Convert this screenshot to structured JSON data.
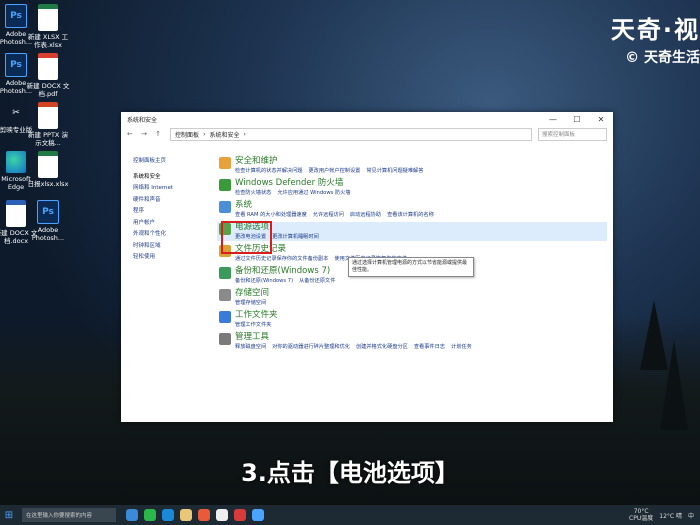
{
  "desktop": {
    "icons": [
      {
        "label": "Adobe Photosh...",
        "type": "ps",
        "glyph": "Ps"
      },
      {
        "label": "新建 XLSX 工作表.xlsx",
        "type": "xl",
        "glyph": ""
      },
      {
        "label": "Adobe Photosh...",
        "type": "ps",
        "glyph": "Ps"
      },
      {
        "label": "新建 DOCX 文档.pdf",
        "type": "pdf",
        "glyph": ""
      },
      {
        "label": "剪映专业版",
        "type": "capcut",
        "glyph": "✂"
      },
      {
        "label": "新建 PPTX 演示文稿...",
        "type": "ppt",
        "glyph": ""
      },
      {
        "label": "Microsoft Edge",
        "type": "edge",
        "glyph": ""
      },
      {
        "label": "日报xlsx.xlsx",
        "type": "xl",
        "glyph": ""
      },
      {
        "label": "新建 DOCX 文档.docx",
        "type": "doc",
        "glyph": "W"
      },
      {
        "label": "Adobe Photosh...",
        "type": "ps",
        "glyph": "Ps"
      }
    ]
  },
  "brand": {
    "line1": "天奇·视",
    "line2": "© 天奇生活"
  },
  "window": {
    "title": "系统和安全",
    "controls": {
      "minimize": "—",
      "maximize": "☐",
      "close": "✕"
    },
    "nav_glyphs": "← → ↑",
    "breadcrumb": [
      "控制面板",
      "系统和安全"
    ],
    "search_placeholder": "搜索控制面板"
  },
  "sidebar": {
    "items": [
      "控制面板主页",
      "系统和安全",
      "网络和 Internet",
      "硬件和声音",
      "程序",
      "用户帐户",
      "外观和个性化",
      "时钟和区域",
      "轻松使用"
    ]
  },
  "categories": [
    {
      "title": "安全和维护",
      "links": [
        "检查计算机的状态并解决问题",
        "更改用户帐户控制设置",
        "常见计算机问题疑难解答"
      ],
      "color": "#e8a23c"
    },
    {
      "title": "Windows Defender 防火墙",
      "links": [
        "检查防火墙状态",
        "允许应用通过 Windows 防火墙"
      ],
      "color": "#3a9a3a"
    },
    {
      "title": "系统",
      "links": [
        "查看 RAM 的大小和处理器速度",
        "允许远程访问",
        "启动远程协助",
        "查看该计算机的名称"
      ],
      "color": "#4a8fd8"
    },
    {
      "title": "电源选项",
      "links": [
        "更改电池设置",
        "更改计算机睡眠时间"
      ],
      "color": "#5aa04a"
    },
    {
      "title": "文件历史记录",
      "links": [
        "通过文件历史记录保存你的文件备份副本",
        "使用文件历史记录恢复你的文件"
      ],
      "color": "#d9a236"
    },
    {
      "title": "备份和还原(Windows 7)",
      "links": [
        "备份和还原(Windows 7)",
        "从备份还原文件"
      ],
      "color": "#3a9a5a"
    },
    {
      "title": "存储空间",
      "links": [
        "管理存储空间"
      ],
      "color": "#8a8a8a"
    },
    {
      "title": "工作文件夹",
      "links": [
        "管理工作文件夹"
      ],
      "color": "#3a7ad8"
    },
    {
      "title": "管理工具",
      "links": [
        "释放磁盘空间",
        "对你的驱动器进行碎片整理和优化",
        "创建并格式化硬盘分区",
        "查看事件日志",
        "计划任务"
      ],
      "color": "#7a7a7a"
    }
  ],
  "tooltip": "通过选择计算机管理电源的方式以节省能源或提供最佳性能。",
  "caption": "3.点击【电池选项】",
  "taskbar": {
    "search_placeholder": "在这里输入你要搜索的内容",
    "weather_temp": "70°C",
    "weather_label": "CPU温度",
    "temp": "12°C 晴",
    "lang": "中"
  }
}
